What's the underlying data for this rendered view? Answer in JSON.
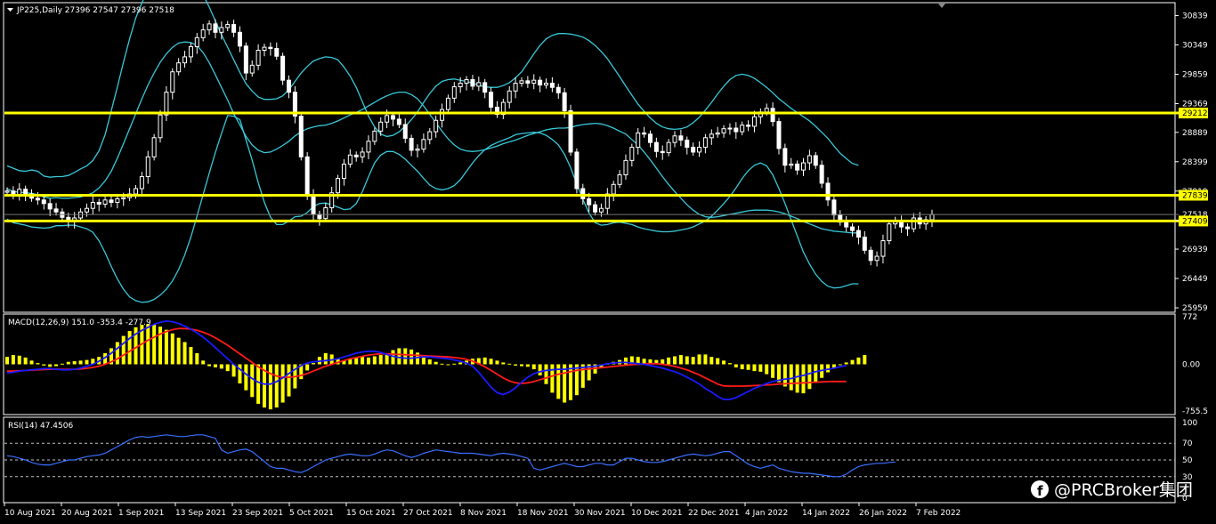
{
  "header": {
    "symbol_line": "JP225,Daily  27396 27547 27396 27518",
    "macd_title": "MACD(12,26,9) 151.0 -353.4 -277.9",
    "rsi_title": "RSI(14) 47.4506"
  },
  "watermark": {
    "text": "@PRCBroker集团",
    "icon": "facebook-icon"
  },
  "colors": {
    "background": "#000000",
    "bull_candle": "#ffffff",
    "bear_candle": "#ffffff",
    "bands": "#38c8d8",
    "level_lines": "#ffff00",
    "macd_hist": "#ffff00",
    "macd_line": "#1a1aff",
    "signal_line": "#ff1a1a",
    "rsi_line": "#3a6fff"
  },
  "chart_data": [
    {
      "type": "candlestick",
      "title": "JP225,Daily",
      "ohlc_latest": {
        "open": 27396,
        "high": 27547,
        "low": 27396,
        "close": 27518
      },
      "x_labels": [
        "10 Aug 2021",
        "20 Aug 2021",
        "1 Sep 2021",
        "13 Sep 2021",
        "23 Sep 2021",
        "5 Oct 2021",
        "15 Oct 2021",
        "27 Oct 2021",
        "8 Nov 2021",
        "18 Nov 2021",
        "30 Nov 2021",
        "10 Dec 2021",
        "22 Dec 2021",
        "4 Jan 2022",
        "14 Jan 2022",
        "26 Jan 2022",
        "7 Feb 2022"
      ],
      "y_ticks": [
        30839,
        30349,
        29859,
        29369,
        28889,
        28399,
        27909,
        27419,
        26939,
        26449,
        25959
      ],
      "y_tick_labels": [
        "30839",
        "30349",
        "29859",
        "29369",
        "28889",
        "28399",
        "27919",
        "27419",
        "26939",
        "26449",
        "25959"
      ],
      "ylim": [
        25900,
        31040
      ],
      "levels": [
        {
          "value": 29212,
          "label": "29212"
        },
        {
          "value": 27839,
          "label": "27839"
        },
        {
          "value": 27409,
          "label": "27409"
        }
      ],
      "current_price": {
        "value": 27518,
        "label": "27518"
      },
      "close": [
        27910,
        27850,
        27940,
        27860,
        27790,
        27760,
        27700,
        27610,
        27560,
        27470,
        27400,
        27460,
        27560,
        27620,
        27720,
        27690,
        27760,
        27720,
        27780,
        27800,
        27860,
        27950,
        28150,
        28480,
        28800,
        29180,
        29560,
        29900,
        30050,
        30150,
        30320,
        30470,
        30600,
        30700,
        30560,
        30640,
        30690,
        30560,
        30330,
        29880,
        30010,
        30260,
        30310,
        30290,
        30160,
        29760,
        29560,
        29160,
        28480,
        27840,
        27520,
        27450,
        27630,
        27880,
        28120,
        28360,
        28510,
        28480,
        28560,
        28740,
        28910,
        29060,
        29170,
        29110,
        29020,
        28790,
        28590,
        28610,
        28770,
        28900,
        29090,
        29270,
        29460,
        29650,
        29710,
        29770,
        29660,
        29720,
        29560,
        29310,
        29190,
        29390,
        29580,
        29710,
        29750,
        29710,
        29760,
        29680,
        29710,
        29640,
        29550,
        29250,
        28560,
        27950,
        27780,
        27680,
        27560,
        27620,
        27860,
        28020,
        28180,
        28420,
        28640,
        28880,
        28860,
        28720,
        28570,
        28550,
        28720,
        28830,
        28760,
        28640,
        28560,
        28640,
        28800,
        28860,
        28880,
        28950,
        28960,
        28900,
        29010,
        28990,
        29150,
        29230,
        29290,
        29070,
        28620,
        28340,
        28360,
        28260,
        28380,
        28500,
        28340,
        28040,
        27760,
        27510,
        27390,
        27310,
        27250,
        27140,
        26920,
        26750,
        26820,
        27080,
        27360,
        27400,
        27310,
        27280,
        27460,
        27360,
        27430,
        27518
      ],
      "bb_upper": [
        28330,
        28290,
        28250,
        28240,
        28260,
        28240,
        28160,
        28140,
        28150,
        28150,
        28170,
        28220,
        28280,
        28330,
        28420,
        28580,
        28850,
        29250,
        29650,
        30060,
        30450,
        30800,
        31050,
        31300,
        31500,
        31600,
        31650,
        31660,
        31650,
        31600,
        31500,
        31350,
        31180,
        30980,
        30750,
        30520,
        30310,
        30100,
        29890,
        29700,
        29580,
        29480,
        29440,
        29440,
        29450,
        29500,
        29600,
        29740,
        29880,
        29990,
        30080,
        30120,
        30150,
        30140,
        30100,
        29980,
        29830,
        29640,
        29400,
        29160,
        28980,
        28860,
        28820,
        28840,
        28900,
        28990,
        29100,
        29230,
        29390,
        29540,
        29660,
        29740,
        29770,
        29780,
        29760,
        29740,
        29710,
        29680,
        29650,
        29640,
        29640,
        29670,
        29720,
        29800,
        29900,
        30050,
        30200,
        30340,
        30450,
        30510,
        30540,
        30540,
        30530,
        30510,
        30480,
        30420,
        30340,
        30240,
        30120,
        29970,
        29820,
        29660,
        29510,
        29360,
        29240,
        29130,
        29040,
        28980,
        28950,
        28940,
        28950,
        28980,
        29050,
        29140,
        29260,
        29390,
        29530,
        29660,
        29770,
        29840,
        29860,
        29840,
        29790,
        29720,
        29640,
        29550,
        29450,
        29370,
        29290,
        29220,
        29150,
        29080,
        28990,
        28890,
        28790,
        28660,
        28540,
        28450,
        28370,
        28340
      ],
      "bb_lower": [
        27440,
        27380,
        27360,
        27340,
        27310,
        27300,
        27290,
        27300,
        27330,
        27330,
        27340,
        27340,
        27310,
        27280,
        27220,
        27080,
        26880,
        26650,
        26440,
        26270,
        26140,
        26080,
        26050,
        26060,
        26100,
        26170,
        26270,
        26410,
        26600,
        26840,
        27140,
        27490,
        27850,
        28210,
        28550,
        28870,
        29170,
        29160,
        29100,
        28760,
        28430,
        28050,
        27720,
        27470,
        27350,
        27350,
        27410,
        27480,
        27490,
        27550,
        27650,
        27700,
        27710,
        27680,
        27640,
        27600,
        27610,
        27700,
        27900,
        28150,
        28380,
        28510,
        28570,
        28570,
        28520,
        28440,
        28340,
        28240,
        28120,
        28010,
        27950,
        27930,
        27950,
        28000,
        28100,
        28240,
        28380,
        28500,
        28600,
        28670,
        28720,
        28760,
        28800,
        28850,
        28870,
        28880,
        28890,
        28880,
        28840,
        28770,
        28680,
        28520,
        28300,
        28030,
        27770,
        27540,
        27380,
        27340,
        27350,
        27380,
        27390,
        27370,
        27350,
        27310,
        27280,
        27260,
        27240,
        27230,
        27230,
        27240,
        27260,
        27280,
        27310,
        27360,
        27410,
        27490,
        27590,
        27700,
        27820,
        27960,
        28120,
        28250,
        28340,
        28380,
        28330,
        28180,
        27950,
        27700,
        27430,
        27160,
        26890,
        26690,
        26520,
        26400,
        26320,
        26290,
        26300,
        26330,
        26360,
        26360
      ],
      "bb_mid": [
        27950,
        27900,
        27890,
        27880,
        27870,
        27850,
        27810,
        27790,
        27800,
        27790,
        27790,
        27800,
        27810,
        27840,
        27880,
        27960,
        28080,
        28240,
        28460,
        28700,
        28950,
        29200,
        29450,
        29680,
        29880,
        30060,
        30200,
        30310,
        30380,
        30400,
        30390,
        30340,
        30220,
        30050,
        29850,
        29640,
        29430,
        29200,
        29010,
        28820,
        28680,
        28590,
        28550,
        28560,
        28610,
        28670,
        28740,
        28830,
        28900,
        28950,
        28980,
        29000,
        29010,
        29040,
        29080,
        29130,
        29180,
        29220,
        29270,
        29330,
        29390,
        29450,
        29500,
        29540,
        29560,
        29560,
        29520,
        29450,
        29330,
        29190,
        29050,
        28910,
        28780,
        28680,
        28610,
        28580,
        28570,
        28580,
        28600,
        28630,
        28660,
        28700,
        28730,
        28760,
        28800,
        28840,
        28870,
        28900,
        28930,
        28950,
        28960,
        28960,
        28970,
        29000,
        29020,
        29030,
        29040,
        29030,
        29000,
        28960,
        28910,
        28860,
        28770,
        28680,
        28560,
        28430,
        28290,
        28150,
        28020,
        27900,
        27790,
        27680,
        27590,
        27520,
        27480,
        27470,
        27480,
        27500,
        27520,
        27540,
        27560,
        27580,
        27590,
        27590,
        27590,
        27580,
        27560,
        27530,
        27490,
        27450,
        27400,
        27360,
        27320,
        27280,
        27260,
        27240,
        27230,
        27220,
        27210,
        27210
      ],
      "bb_band_x_range_note": "Bollinger bands"
    },
    {
      "type": "bar+line",
      "title": "MACD(12,26,9)",
      "values_header": [
        151.0,
        -353.4,
        -277.9
      ],
      "y_tick_labels": [
        "772",
        "0.00",
        "-755.5"
      ],
      "ylim": [
        -800,
        800
      ],
      "histogram": [
        120,
        150,
        140,
        110,
        60,
        20,
        -20,
        -40,
        -30,
        10,
        40,
        50,
        60,
        70,
        90,
        120,
        180,
        260,
        360,
        460,
        540,
        600,
        640,
        650,
        640,
        610,
        560,
        500,
        430,
        360,
        280,
        180,
        60,
        -30,
        -50,
        -70,
        -110,
        -200,
        -310,
        -420,
        -530,
        -640,
        -700,
        -730,
        -700,
        -620,
        -520,
        -390,
        -240,
        -100,
        20,
        120,
        180,
        160,
        90,
        60,
        90,
        110,
        120,
        110,
        130,
        150,
        180,
        230,
        260,
        260,
        240,
        190,
        130,
        80,
        40,
        10,
        0,
        10,
        30,
        60,
        90,
        100,
        110,
        90,
        60,
        30,
        10,
        -20,
        -30,
        -40,
        -80,
        -180,
        -320,
        -460,
        -560,
        -620,
        -580,
        -500,
        -380,
        -260,
        -150,
        -60,
        10,
        40,
        70,
        110,
        130,
        120,
        90,
        80,
        70,
        80,
        110,
        130,
        150,
        130,
        120,
        160,
        160,
        120,
        100,
        60,
        20,
        -50,
        -80,
        -90,
        -110,
        -120,
        -160,
        -220,
        -290,
        -360,
        -420,
        -460,
        -470,
        -400,
        -300,
        -220,
        -130,
        -60,
        0,
        30,
        70,
        110,
        151
      ],
      "macd": [
        -140,
        -130,
        -110,
        -100,
        -90,
        -80,
        -70,
        -70,
        -80,
        -90,
        -90,
        -80,
        -60,
        -30,
        0,
        50,
        110,
        180,
        260,
        340,
        420,
        490,
        550,
        600,
        650,
        680,
        700,
        690,
        660,
        620,
        570,
        510,
        440,
        360,
        270,
        180,
        90,
        0,
        -80,
        -160,
        -230,
        -290,
        -320,
        -320,
        -280,
        -220,
        -150,
        -80,
        -20,
        20,
        40,
        50,
        60,
        70,
        90,
        120,
        150,
        180,
        200,
        210,
        210,
        190,
        160,
        130,
        110,
        100,
        100,
        110,
        120,
        120,
        110,
        100,
        90,
        70,
        50,
        20,
        -30,
        -130,
        -250,
        -370,
        -460,
        -490,
        -450,
        -380,
        -290,
        -210,
        -150,
        -120,
        -100,
        -90,
        -80,
        -80,
        -70,
        -60,
        -50,
        -40,
        -30,
        -10,
        10,
        20,
        30,
        30,
        20,
        10,
        0,
        -20,
        -40,
        -60,
        -90,
        -120,
        -160,
        -210,
        -260,
        -320,
        -390,
        -450,
        -520,
        -570,
        -570,
        -540,
        -490,
        -440,
        -390,
        -350,
        -310,
        -278,
        -260,
        -240,
        -230,
        -200,
        -180,
        -150,
        -120,
        -100,
        -80,
        -60,
        -40,
        -20
      ],
      "signal": [
        -110,
        -110,
        -105,
        -100,
        -95,
        -90,
        -85,
        -80,
        -78,
        -80,
        -82,
        -80,
        -75,
        -65,
        -50,
        -30,
        0,
        40,
        90,
        150,
        210,
        270,
        330,
        390,
        440,
        490,
        530,
        560,
        580,
        580,
        570,
        550,
        520,
        480,
        430,
        370,
        310,
        240,
        170,
        100,
        30,
        -40,
        -100,
        -150,
        -190,
        -210,
        -210,
        -200,
        -180,
        -150,
        -110,
        -70,
        -30,
        0,
        30,
        60,
        90,
        110,
        130,
        150,
        160,
        170,
        170,
        165,
        160,
        155,
        150,
        145,
        140,
        135,
        130,
        125,
        120,
        110,
        100,
        80,
        50,
        10,
        -40,
        -100,
        -160,
        -220,
        -270,
        -300,
        -310,
        -300,
        -280,
        -250,
        -220,
        -190,
        -160,
        -140,
        -120,
        -100,
        -85,
        -75,
        -65,
        -55,
        -45,
        -35,
        -25,
        -15,
        -5,
        0,
        5,
        10,
        10,
        0,
        -15,
        -35,
        -60,
        -90,
        -130,
        -170,
        -220,
        -270,
        -320,
        -350,
        -353,
        -353,
        -353,
        -350,
        -345,
        -340,
        -335,
        -330,
        -320,
        -315,
        -310,
        -305,
        -300,
        -295,
        -290,
        -285,
        -280,
        -278,
        -278,
        -278
      ]
    },
    {
      "type": "line",
      "title": "RSI(14)",
      "latest": 47.4506,
      "y_tick_labels": [
        "100",
        "70",
        "50",
        "30",
        "0"
      ],
      "ylim": [
        0,
        100
      ],
      "levels": [
        70,
        50,
        30
      ],
      "values": [
        55,
        54,
        52,
        50,
        47,
        45,
        44,
        44,
        46,
        48,
        50,
        50,
        52,
        54,
        55,
        56,
        58,
        62,
        66,
        70,
        74,
        77,
        78,
        77,
        78,
        79,
        80,
        79,
        78,
        78,
        79,
        80,
        80,
        78,
        76,
        62,
        58,
        60,
        62,
        63,
        60,
        54,
        48,
        42,
        40,
        40,
        38,
        36,
        35,
        38,
        42,
        46,
        50,
        52,
        54,
        56,
        57,
        56,
        55,
        55,
        57,
        60,
        62,
        61,
        58,
        55,
        53,
        55,
        58,
        60,
        62,
        61,
        60,
        59,
        58,
        58,
        58,
        57,
        56,
        55,
        57,
        58,
        57,
        56,
        54,
        52,
        40,
        38,
        40,
        42,
        44,
        46,
        44,
        42,
        42,
        44,
        46,
        46,
        44,
        44,
        48,
        52,
        52,
        50,
        48,
        47,
        47,
        48,
        50,
        52,
        54,
        56,
        57,
        56,
        55,
        56,
        58,
        60,
        60,
        55,
        50,
        45,
        42,
        40,
        42,
        44,
        40,
        38,
        36,
        35,
        34,
        34,
        33,
        32,
        31,
        30,
        30,
        33,
        38,
        42,
        44,
        45,
        46,
        46,
        47,
        47.45
      ]
    }
  ]
}
